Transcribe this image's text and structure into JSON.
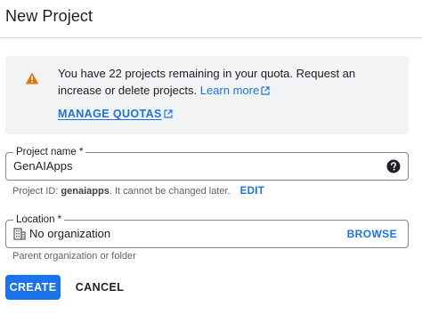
{
  "page": {
    "title": "New Project"
  },
  "quota_banner": {
    "message": "You have 22 projects remaining in your quota. Request an increase or delete projects.",
    "learn_more_label": "Learn more",
    "manage_quotas_label": "MANAGE QUOTAS",
    "icon": "warning-icon",
    "accent_color": "#e37400"
  },
  "project_name": {
    "label": "Project name *",
    "value": "GenAIApps",
    "help_icon": "help-icon"
  },
  "project_id": {
    "prefix": "Project ID:",
    "id": "genaiapps",
    "suffix": ". It cannot be changed later.",
    "edit_label": "EDIT"
  },
  "location": {
    "label": "Location *",
    "value": "No organization",
    "browse_label": "BROWSE",
    "icon": "organization-icon",
    "hint": "Parent organization or folder"
  },
  "actions": {
    "create_label": "CREATE",
    "cancel_label": "CANCEL"
  },
  "colors": {
    "primary": "#1a73e8",
    "banner_bg": "#f1f3f4",
    "warning": "#e37400"
  }
}
